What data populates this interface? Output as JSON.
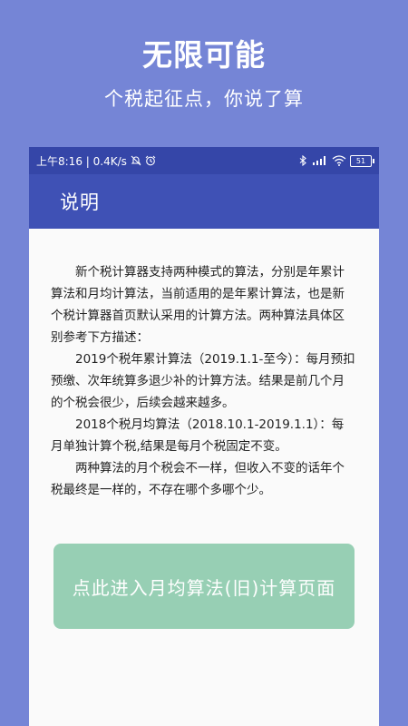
{
  "promo": {
    "title": "无限可能",
    "subtitle": "个税起征点，你说了算"
  },
  "status_bar": {
    "time_speed": "上午8:16 | 0.4K/s",
    "battery": "51",
    "icons": [
      "mute-bell-icon",
      "alarm-icon",
      "bluetooth-icon",
      "signal-icon",
      "wifi-icon",
      "battery-icon"
    ]
  },
  "appbar": {
    "title": "说明"
  },
  "content": {
    "paragraphs": [
      "新个税计算器支持两种模式的算法，分别是年累计算法和月均计算法，当前适用的是年累计算法，也是新个税计算器首页默认采用的计算方法。两种算法具体区别参考下方描述：",
      "2019个税年累计算法（2019.1.1-至今）：每月预扣预缴、次年统算多退少补的计算方法。结果是前几个月的个税会很少，后续会越来越多。",
      "2018个税月均算法（2018.10.1-2019.1.1）：每月单独计算个税,结果是每月个税固定不变。",
      "两种算法的月个税会不一样，但收入不变的话年个税最终是一样的，不存在哪个多哪个少。"
    ]
  },
  "action_button": {
    "label": "点此进入月均算法(旧)计算页面"
  },
  "colors": {
    "background": "#7585d6",
    "statusbar": "#3546a8",
    "appbar": "#3f51b5",
    "button": "#97cfb4"
  }
}
